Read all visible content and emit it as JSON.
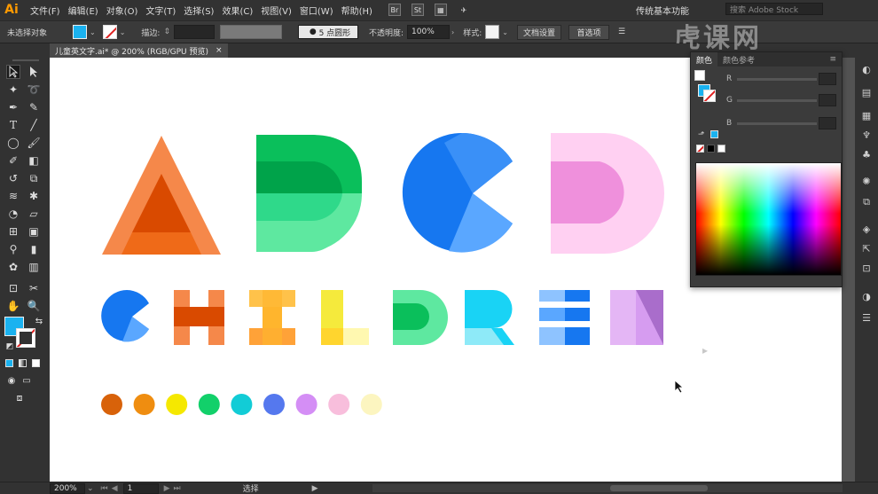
{
  "app": {
    "logo": "Ai",
    "menus": [
      "文件(F)",
      "编辑(E)",
      "对象(O)",
      "文字(T)",
      "选择(S)",
      "效果(C)",
      "视图(V)",
      "窗口(W)",
      "帮助(H)"
    ],
    "bridge_label": "Br",
    "stock_label": "St",
    "workspace": "传统基本功能",
    "stock_search_placeholder": "搜索 Adobe Stock",
    "watermark": "虎课网"
  },
  "control_bar": {
    "selection_status": "未选择对象",
    "stroke_label": "描边:",
    "brush_label": "5 点圆形",
    "opacity_label": "不透明度:",
    "opacity_value": "100%",
    "style_label": "样式:",
    "doc_setup_button": "文档设置",
    "prefs_button": "首选项"
  },
  "document_tab": {
    "title": "儿童英文字.ai* @ 200% (RGB/GPU 预览)",
    "close": "×"
  },
  "color_panel": {
    "tabs": [
      "颜色",
      "颜色参考"
    ],
    "channels": [
      "R",
      "G",
      "B"
    ]
  },
  "status_bar": {
    "zoom": "200%",
    "artboard": "1",
    "tool_name": "选择"
  },
  "artwork": {
    "colors": {
      "orange": "#f58a4a",
      "orange_dark": "#d94a00",
      "green": "#0abf5b",
      "green_dark": "#00a34a",
      "green_light": "#5ee8a0",
      "blue": "#1677f0",
      "blue_light": "#5aa7ff",
      "pink": "#ffd0f2",
      "pink_dark": "#ef90dc",
      "yellow": "#f5ea3c",
      "cyan": "#19d3f5",
      "purple": "#a96dcb",
      "lavender": "#e4b6f5"
    },
    "palette_dots": [
      "#d8620a",
      "#ef8d10",
      "#f5e800",
      "#12d06a",
      "#12ccd6",
      "#5578ee",
      "#d48ef5",
      "#f8bedc",
      "#fcf5c0"
    ]
  }
}
